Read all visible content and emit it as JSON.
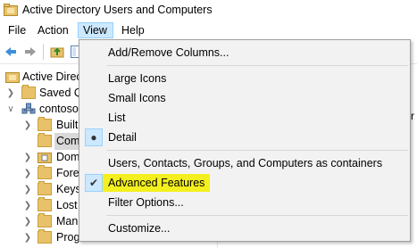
{
  "window": {
    "title": "Active Directory Users and Computers"
  },
  "menubar": {
    "items": [
      {
        "label": "File"
      },
      {
        "label": "Action"
      },
      {
        "label": "View"
      },
      {
        "label": "Help"
      }
    ]
  },
  "tree": {
    "items": [
      {
        "label": "Active Directo"
      },
      {
        "label": "Saved Q"
      },
      {
        "label": "contoso"
      },
      {
        "label": "Built"
      },
      {
        "label": "Com"
      },
      {
        "label": "Dom"
      },
      {
        "label": "Fore"
      },
      {
        "label": "Keys"
      },
      {
        "label": "Lost"
      },
      {
        "label": "Man"
      },
      {
        "label": "Prog"
      }
    ]
  },
  "right_pane": {
    "partial_text": "r"
  },
  "view_menu": {
    "items": [
      {
        "label": "Add/Remove Columns...",
        "mark": ""
      },
      {
        "label": "Large Icons",
        "mark": ""
      },
      {
        "label": "Small Icons",
        "mark": ""
      },
      {
        "label": "List",
        "mark": ""
      },
      {
        "label": "Detail",
        "mark": "●"
      },
      {
        "label": "Users, Contacts, Groups, and Computers as containers",
        "mark": ""
      },
      {
        "label": "Advanced Features",
        "mark": "✔"
      },
      {
        "label": "Filter Options...",
        "mark": ""
      },
      {
        "label": "Customize...",
        "mark": ""
      }
    ]
  },
  "colors": {
    "menu_active_bg": "#cce8ff",
    "highlight_yellow": "#f4f01f",
    "folder": "#e8c26a"
  }
}
